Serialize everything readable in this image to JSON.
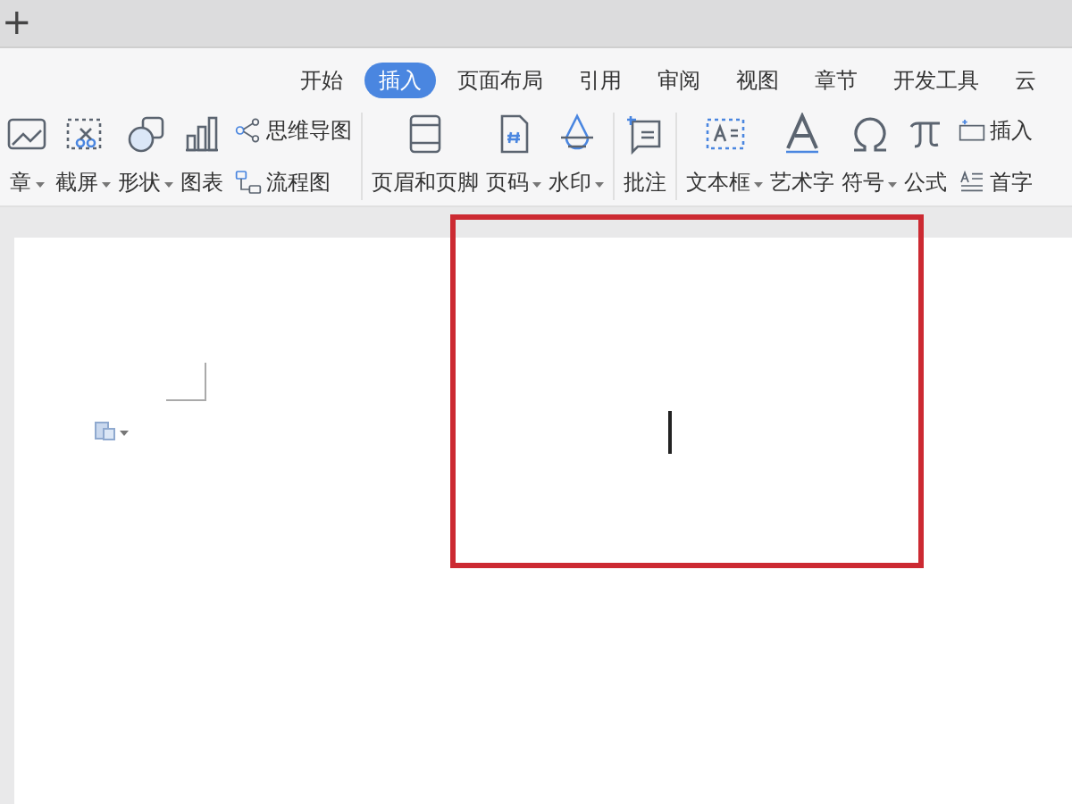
{
  "title_bar": {
    "new_tab": "+"
  },
  "tabs": [
    {
      "label": "开始",
      "selected": false
    },
    {
      "label": "插入",
      "selected": true
    },
    {
      "label": "页面布局",
      "selected": false
    },
    {
      "label": "引用",
      "selected": false
    },
    {
      "label": "审阅",
      "selected": false
    },
    {
      "label": "视图",
      "selected": false
    },
    {
      "label": "章节",
      "selected": false
    },
    {
      "label": "开发工具",
      "selected": false
    },
    {
      "label": "云",
      "selected": false
    }
  ],
  "ribbon": [
    {
      "kind": "large",
      "label": "章",
      "dropdown": true
    },
    {
      "kind": "large",
      "label": "截屏",
      "dropdown": true
    },
    {
      "kind": "large",
      "label": "形状",
      "dropdown": true
    },
    {
      "kind": "large",
      "label": "图表",
      "dropdown": false
    },
    {
      "kind": "pair",
      "items": [
        {
          "label": "思维导图"
        },
        {
          "label": "流程图"
        }
      ]
    },
    {
      "kind": "separator"
    },
    {
      "kind": "large",
      "label": "页眉和页脚",
      "dropdown": false
    },
    {
      "kind": "large",
      "label": "页码",
      "dropdown": true
    },
    {
      "kind": "large",
      "label": "水印",
      "dropdown": true
    },
    {
      "kind": "separator"
    },
    {
      "kind": "large",
      "label": "批注",
      "dropdown": false
    },
    {
      "kind": "separator"
    },
    {
      "kind": "large",
      "label": "文本框",
      "dropdown": true
    },
    {
      "kind": "large",
      "label": "艺术字",
      "dropdown": false
    },
    {
      "kind": "large",
      "label": "符号",
      "dropdown": true
    },
    {
      "kind": "large",
      "label": "公式",
      "dropdown": false
    },
    {
      "kind": "pair",
      "items": [
        {
          "label": "插入"
        },
        {
          "label": "首字"
        }
      ]
    }
  ],
  "document": {
    "highlight_box": true,
    "text_cursor": true
  }
}
